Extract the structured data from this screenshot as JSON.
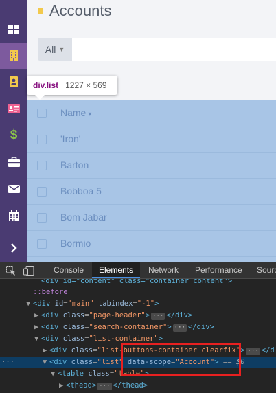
{
  "sidebar": {
    "items": [
      {
        "icon": "grid-icon"
      },
      {
        "icon": "building-icon",
        "active": true
      },
      {
        "icon": "contact-icon"
      },
      {
        "icon": "id-card-icon"
      },
      {
        "icon": "dollar-icon",
        "glyph": "$"
      },
      {
        "icon": "briefcase-icon"
      },
      {
        "icon": "mail-icon"
      },
      {
        "icon": "calendar-icon"
      },
      {
        "icon": "chevron-right-icon",
        "glyph": "›"
      }
    ],
    "colors": {
      "background": "#4a3b72",
      "active": "#7d5a9e",
      "dollar": "#8bc34a",
      "building": "#f2c94c"
    }
  },
  "page": {
    "title": "Accounts",
    "filter_label": "All",
    "search_value": ""
  },
  "list": {
    "header_name": "Name",
    "rows": [
      "'Iron'",
      "Barton",
      "Bobboa 5",
      "Bom Jabar",
      "Bormio"
    ]
  },
  "tooltip": {
    "selector": "div.list",
    "dimensions": "1227 × 569"
  },
  "devtools": {
    "tabs": [
      "Console",
      "Elements",
      "Network",
      "Performance",
      "Sourc"
    ],
    "active_tab": "Elements",
    "lines": {
      "l0": "<div id=\"content\" class=\"container content\">",
      "before": "::before",
      "main_tag": "div",
      "main_attr1": "id",
      "main_val1": "\"main\"",
      "main_attr2": "tabindex",
      "main_val2": "\"-1\"",
      "ph_attr": "class",
      "ph_val": "\"page-header\"",
      "sc_val": "\"search-container\"",
      "lc_val": "\"list-container\"",
      "lbc_val": "\"list-buttons-container clearfix\"",
      "list_val": "\"list\"",
      "scope_attr": "data-scope",
      "scope_val": "\"Account\"",
      "eq_text": "==",
      "dollar_text": "$0",
      "table_tag": "table",
      "table_val": "\"table\"",
      "thead_tag": "thead"
    }
  }
}
